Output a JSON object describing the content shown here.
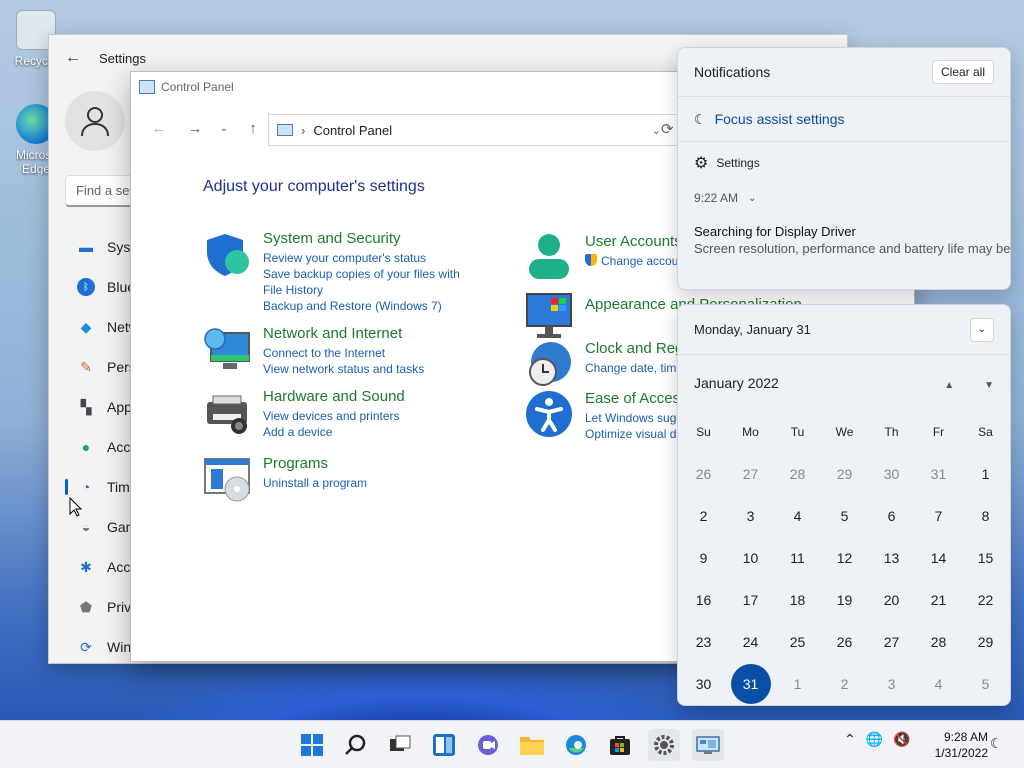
{
  "desktop": {
    "icons": [
      {
        "label": "Recycle"
      },
      {
        "label": "Microsoft Edge"
      }
    ]
  },
  "settings": {
    "title": "Settings",
    "search_placeholder": "Find a setting",
    "nav": [
      {
        "label": "System",
        "icon": "monitor-icon"
      },
      {
        "label": "Bluetooth & devices",
        "icon": "bluetooth-icon"
      },
      {
        "label": "Network & internet",
        "icon": "wifi-icon"
      },
      {
        "label": "Personalization",
        "icon": "brush-icon"
      },
      {
        "label": "Apps",
        "icon": "apps-icon"
      },
      {
        "label": "Accounts",
        "icon": "person-icon"
      },
      {
        "label": "Time & language",
        "icon": "globe-clock-icon"
      },
      {
        "label": "Gaming",
        "icon": "gamepad-icon"
      },
      {
        "label": "Accessibility",
        "icon": "accessibility-icon"
      },
      {
        "label": "Privacy & security",
        "icon": "shield-icon"
      },
      {
        "label": "Windows Update",
        "icon": "update-icon"
      }
    ]
  },
  "control_panel": {
    "title": "Control Panel",
    "address": "Control Panel",
    "heading": "Adjust your computer's settings",
    "categories_left": [
      {
        "title": "System and Security",
        "links": [
          "Review your computer's status",
          "Save backup copies of your files with File History",
          "Backup and Restore (Windows 7)"
        ]
      },
      {
        "title": "Network and Internet",
        "links": [
          "Connect to the Internet",
          "View network status and tasks"
        ]
      },
      {
        "title": "Hardware and Sound",
        "links": [
          "View devices and printers",
          "Add a device"
        ]
      },
      {
        "title": "Programs",
        "links": [
          "Uninstall a program"
        ]
      }
    ],
    "categories_right": [
      {
        "title": "User Accounts",
        "links": [
          "Change account type"
        ]
      },
      {
        "title": "Appearance and Personalization",
        "links": []
      },
      {
        "title": "Clock and Region",
        "links": [
          "Change date, time, or number formats"
        ]
      },
      {
        "title": "Ease of Access",
        "links": [
          "Let Windows suggest settings",
          "Optimize visual display"
        ]
      }
    ]
  },
  "notifications": {
    "title": "Notifications",
    "clear_all": "Clear all",
    "focus_assist": "Focus assist settings",
    "app": "Settings",
    "time": "9:22 AM",
    "item_title": "Searching for Display Driver",
    "item_body": "Screen resolution, performance and battery life may be limited."
  },
  "calendar": {
    "date_header": "Monday, January 31",
    "month": "January 2022",
    "weekdays": [
      "Su",
      "Mo",
      "Tu",
      "We",
      "Th",
      "Fr",
      "Sa"
    ],
    "weeks": [
      [
        "26",
        "27",
        "28",
        "29",
        "30",
        "31",
        "1"
      ],
      [
        "2",
        "3",
        "4",
        "5",
        "6",
        "7",
        "8"
      ],
      [
        "9",
        "10",
        "11",
        "12",
        "13",
        "14",
        "15"
      ],
      [
        "16",
        "17",
        "18",
        "19",
        "20",
        "21",
        "22"
      ],
      [
        "23",
        "24",
        "25",
        "26",
        "27",
        "28",
        "29"
      ],
      [
        "30",
        "31",
        "1",
        "2",
        "3",
        "4",
        "5"
      ]
    ],
    "today": "31"
  },
  "taskbar": {
    "time": "9:28 AM",
    "date": "1/31/2022"
  },
  "colors": {
    "accent": "#0067c0",
    "link": "#1a5fb4",
    "category_title": "#1e7a2e",
    "today_bg": "#0a4fa6"
  }
}
